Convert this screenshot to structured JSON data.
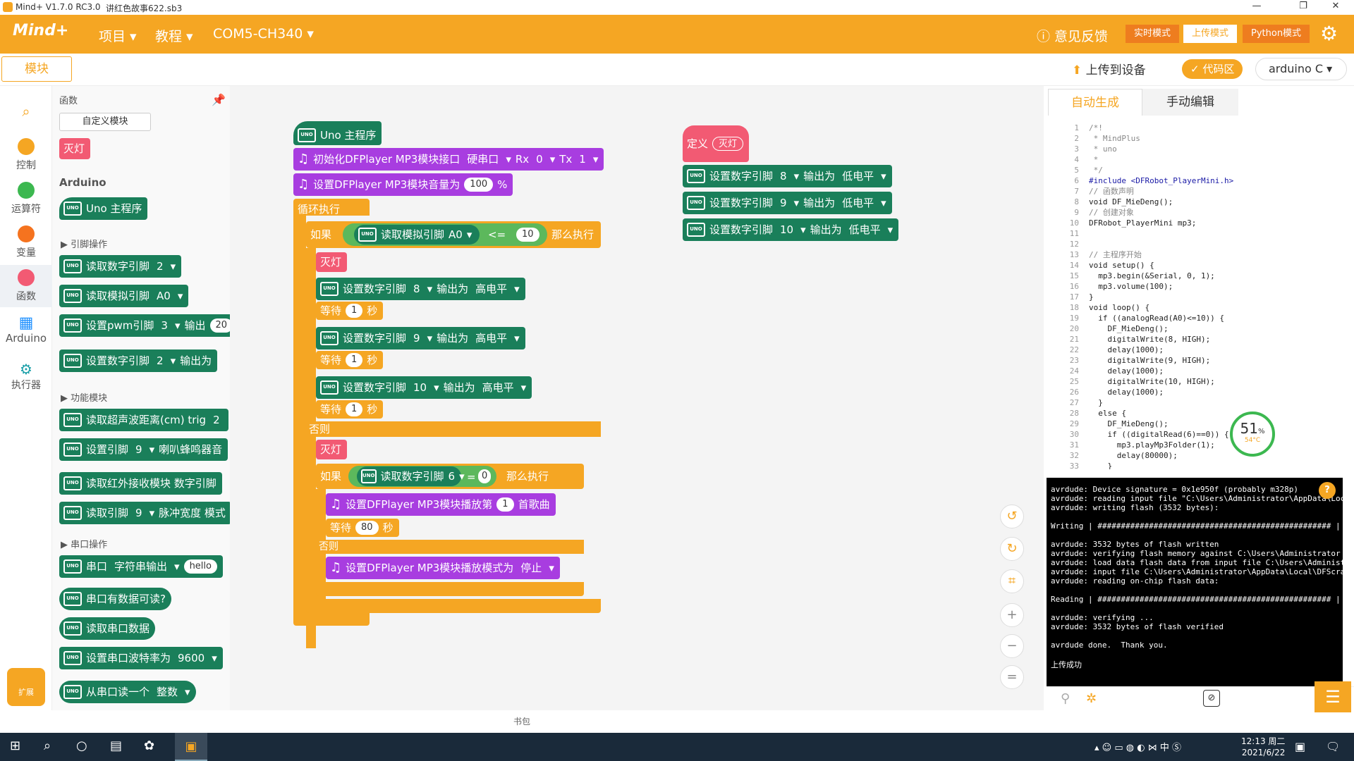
{
  "title": {
    "app": "Mind+ V1.7.0 RC3.0",
    "file": "讲红色故事622.sb3"
  },
  "menu": {
    "project": "项目",
    "tutorial": "教程",
    "port": "COM5-CH340",
    "feedback": "意见反馈",
    "modes": [
      "实时模式",
      "上传模式",
      "Python模式"
    ]
  },
  "subbar": {
    "module_tab": "模块",
    "upload": "上传到设备",
    "code_area": "代码区",
    "board": "arduino C"
  },
  "categories": [
    "控制",
    "运算符",
    "变量",
    "函数",
    "Arduino",
    "执行器"
  ],
  "flyout": {
    "section": "函数",
    "custom_btn": "自定义模块",
    "func_block": "灭灯",
    "arduino": "Arduino",
    "groups": [
      "引脚操作",
      "功能模块",
      "串口操作"
    ],
    "blocks": [
      {
        "t": "Uno 主程序"
      },
      {
        "t": "读取数字引脚",
        "v": "2"
      },
      {
        "t": "读取模拟引脚",
        "v": "A0"
      },
      {
        "t": "设置pwm引脚",
        "v": "3",
        "x": "输出",
        "y": "20"
      },
      {
        "t": "设置数字引脚",
        "v": "2",
        "x": "输出为"
      },
      {
        "t": "读取超声波距离(cm) trig",
        "v": "2"
      },
      {
        "t": "设置引脚",
        "v": "9",
        "x": "喇叭蜂鸣器音"
      },
      {
        "t": "读取红外接收模块 数字引脚"
      },
      {
        "t": "读取引脚",
        "v": "9",
        "x": "脉冲宽度 模式"
      },
      {
        "t": "串口",
        "v": "字符串输出",
        "x": "hello"
      },
      {
        "t": "串口有数据可读?"
      },
      {
        "t": "读取串口数据"
      },
      {
        "t": "设置串口波特率为",
        "v": "9600"
      },
      {
        "t": "从串口读一个",
        "v": "整数"
      }
    ]
  },
  "script": {
    "main": "Uno 主程序",
    "init": "初始化DFPlayer MP3模块接口",
    "init_port": "硬串口",
    "rx": "Rx",
    "rx_v": "0",
    "tx": "Tx",
    "tx_v": "1",
    "volume": "设置DFPlayer MP3模块音量为",
    "volume_v": "100",
    "volume_u": "%",
    "loop": "循环执行",
    "if": "如果",
    "then": "那么执行",
    "else": "否则",
    "read_analog": "读取模拟引脚",
    "analog_pin": "A0",
    "op_le": "<=",
    "cmp_v": "10",
    "func": "灭灯",
    "set_pin": "设置数字引脚",
    "out": "输出为",
    "high": "高电平",
    "low": "低电平",
    "pins": [
      "8",
      "9",
      "10"
    ],
    "wait": "等待",
    "wait_v": "1",
    "sec": "秒",
    "read_digital": "读取数字引脚",
    "dpin": "6",
    "op_eq": "=",
    "eq_v": "0",
    "play": "设置DFPlayer MP3模块播放第",
    "play_v": "1",
    "song": "首歌曲",
    "wait2": "80",
    "mode": "设置DFPlayer MP3模块播放模式为",
    "mode_v": "停止",
    "define": "定义",
    "define_name": "灭灯"
  },
  "code_tabs": [
    "自动生成",
    "手动编辑"
  ],
  "code": [
    "/*!",
    " * MindPlus",
    " * uno",
    " *",
    " */",
    "#include <DFRobot_PlayerMini.h>",
    "// 函数声明",
    "void DF_MieDeng();",
    "// 创建对象",
    "DFRobot_PlayerMini mp3;",
    "",
    "",
    "// 主程序开始",
    "void setup() {",
    "  mp3.begin(&Serial, 0, 1);",
    "  mp3.volume(100);",
    "}",
    "void loop() {",
    "  if ((analogRead(A0)<=10)) {",
    "    DF_MieDeng();",
    "    digitalWrite(8, HIGH);",
    "    delay(1000);",
    "    digitalWrite(9, HIGH);",
    "    delay(1000);",
    "    digitalWrite(10, HIGH);",
    "    delay(1000);",
    "  }",
    "  else {",
    "    DF_MieDeng();",
    "    if ((digitalRead(6)==0)) {",
    "      mp3.playMp3Folder(1);",
    "      delay(80000);",
    "    }"
  ],
  "cpu": {
    "pct": "51",
    "unit": "%",
    "temp": "54°C"
  },
  "console": "avrdude: Device signature = 0x1e950f (probably m328p)\navrdude: reading input file \"C:\\Users\\Administrator\\AppData\\Loc\navrdude: writing flash (3532 bytes):\n\nWriting | ################################################## |\n\navrdude: 3532 bytes of flash written\navrdude: verifying flash memory against C:\\Users\\Administrator\navrdude: load data flash data from input file C:\\Users\\Administ\navrdude: input file C:\\Users\\Administrator\\AppData\\Local\\DFScra\navrdude: reading on-chip flash data:\n\nReading | ################################################## |\n\navrdude: verifying ...\navrdude: 3532 bytes of flash verified\n\navrdude done.  Thank you.\n\n上传成功",
  "bottom": "书包",
  "ext_btn": "扩展",
  "clock": {
    "time": "12:13 周二",
    "date": "2021/6/22"
  }
}
